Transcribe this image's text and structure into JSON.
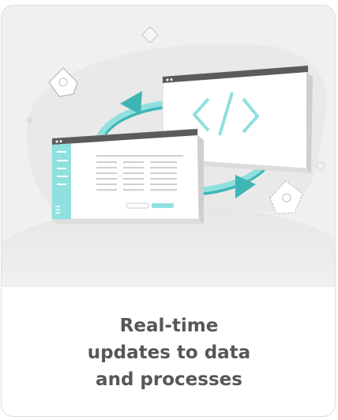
{
  "card": {
    "caption_lines": [
      "Real-time",
      "updates to data",
      "and processes"
    ]
  },
  "illustration": {
    "icons": [
      "code-window-icon",
      "data-table-window-icon",
      "sync-arrows-icon",
      "document-icon"
    ],
    "colors": {
      "accent": "#6fd3d3",
      "accent_dark": "#3fb5b5",
      "window_bar": "#5b5b5b",
      "background": "#f0f0f0",
      "caption_text": "#555759"
    }
  }
}
